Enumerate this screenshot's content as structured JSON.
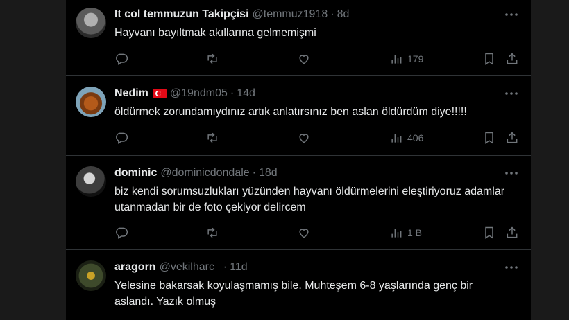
{
  "tweets": [
    {
      "name": "It col temmuzun Takipçisi",
      "handle": "@temmuz1918",
      "time": "8d",
      "text": "Hayvanı bayıltmak akıllarına gelmemişmi",
      "views": "179",
      "flag": false
    },
    {
      "name": "Nedim",
      "handle": "@19ndm05",
      "time": "14d",
      "text": "öldürmek zorundamıydınız artık anlatırsınız ben aslan öldürdüm diye!!!!!",
      "views": "406",
      "flag": true
    },
    {
      "name": "dominic",
      "handle": "@dominicdondale",
      "time": "18d",
      "text": "biz kendi sorumsuzlukları yüzünden hayvanı öldürmelerini eleştiriyoruz adamlar utanmadan bir de foto çekiyor delircem",
      "views": "1 B",
      "flag": false
    },
    {
      "name": "aragorn",
      "handle": "@vekilharc_",
      "time": "11d",
      "text": "Yelesine bakarsak koyulaşmamış bile. Muhteşem 6-8 yaşlarında genç bir aslandı. Yazık olmuş",
      "flag": false
    }
  ],
  "separator": "·",
  "icons": [
    "more-icon",
    "reply-icon",
    "retweet-icon",
    "like-icon",
    "views-icon",
    "bookmark-icon",
    "share-icon"
  ],
  "colors": {
    "background": "#000000",
    "text": "#e7e9ea",
    "muted": "#71767b",
    "border": "#2f3336"
  }
}
